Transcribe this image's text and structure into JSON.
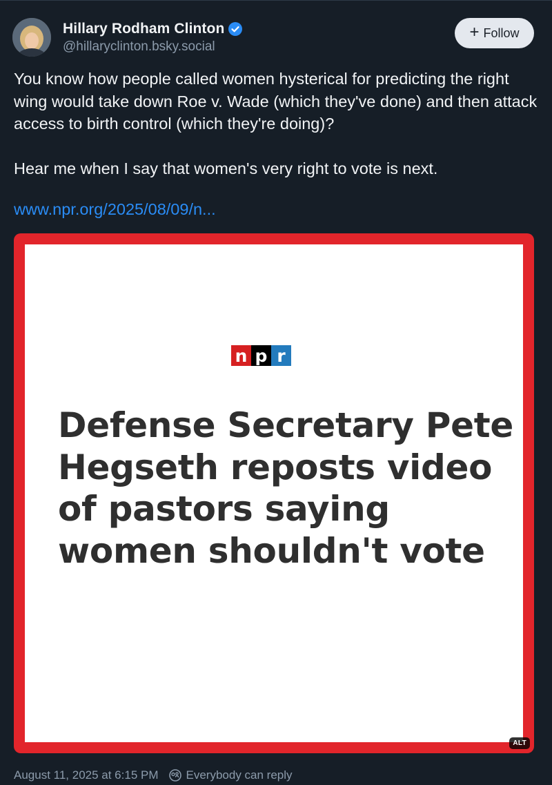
{
  "author": {
    "name": "Hillary Rodham Clinton",
    "handle": "@hillaryclinton.bsky.social",
    "verified": true
  },
  "follow_button": {
    "label": "Follow",
    "icon": "plus-icon"
  },
  "post": {
    "paragraph_1": "You know how people called women hysterical for predicting the right wing would take down Roe v. Wade (which they've done) and then attack access to birth control (which they're doing)?",
    "paragraph_2": "Hear me when I say that women's very right to vote is next.",
    "link_text": "www.npr.org/2025/08/09/n..."
  },
  "embed": {
    "logo": {
      "n": "n",
      "p": "p",
      "r": "r"
    },
    "headline": "Defense Secretary Pete Hegseth reposts video of pastors saying women shouldn't vote",
    "alt_badge": "ALT",
    "border_color": "#e2252b"
  },
  "footer": {
    "timestamp": "August 11, 2025 at 6:15 PM",
    "reply_setting": "Everybody can reply"
  },
  "colors": {
    "background": "#161e27",
    "link": "#2a8cf5",
    "muted": "#8c9bab",
    "verified": "#2a8cf5"
  }
}
